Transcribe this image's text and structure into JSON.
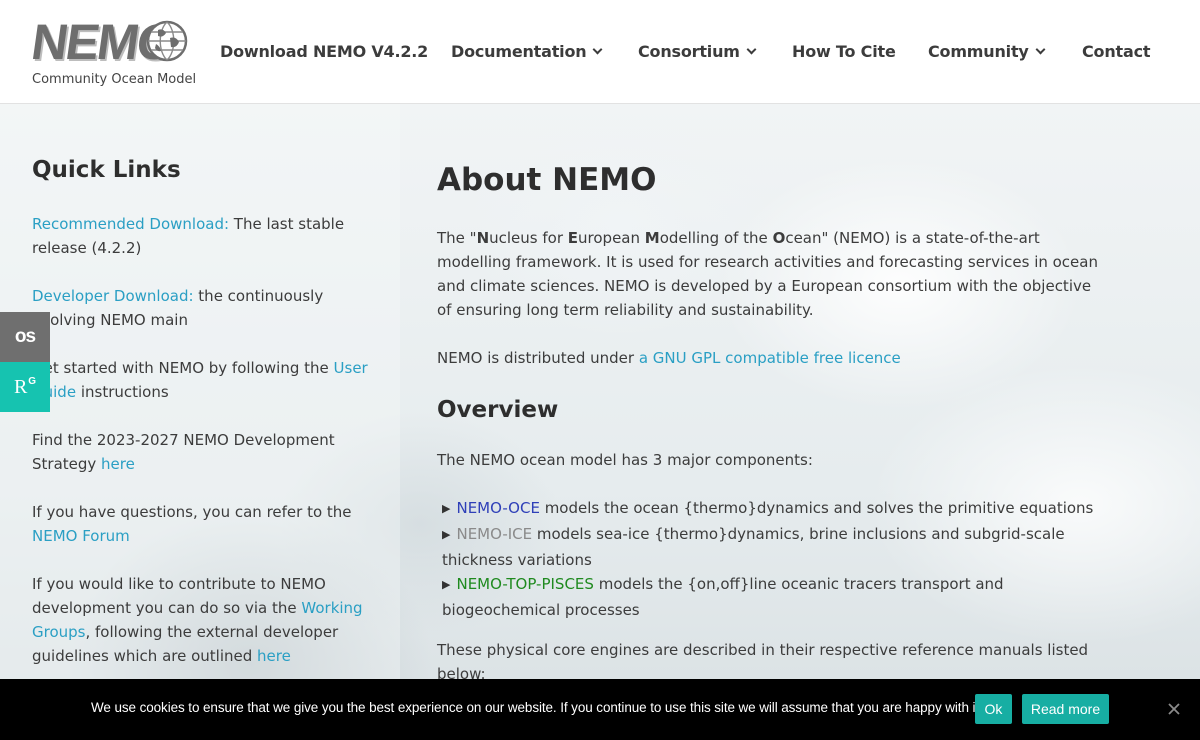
{
  "header": {
    "logo_text": "NEMO",
    "logo_subtitle": "Community Ocean Model",
    "nav": [
      {
        "label": "Download NEMO V4.2.2",
        "dropdown": false
      },
      {
        "label": "Documentation",
        "dropdown": true
      },
      {
        "label": "Consortium",
        "dropdown": true
      },
      {
        "label": "How To Cite",
        "dropdown": false
      },
      {
        "label": "Community",
        "dropdown": true
      },
      {
        "label": "Contact",
        "dropdown": false
      }
    ]
  },
  "sidebar": {
    "title": "Quick Links",
    "items": [
      {
        "link": "Recommended Download:",
        "text": " The last stable release (4.2.2)"
      },
      {
        "link": "Developer Download:",
        "text": " the continuously evolving NEMO main"
      },
      {
        "pre": "Get started with NEMO by following the ",
        "link": "User Guide",
        "text": " instructions"
      },
      {
        "pre": "Find the 2023-2027 NEMO Development Strategy ",
        "link": "here",
        "text": ""
      },
      {
        "pre": "If you have questions, you can refer to the ",
        "link": "NEMO Forum",
        "text": ""
      },
      {
        "pre": "If you would like to contribute to NEMO development you can do so via the ",
        "link": "Working Groups",
        "mid": ", following the external developer guidelines which are outlined ",
        "link2": "here"
      }
    ]
  },
  "main": {
    "title": "About NEMO",
    "about": {
      "q_open": "The \"",
      "N": "N",
      "n_rest": "ucleus for ",
      "E": "E",
      "e_rest": "uropean ",
      "M": "M",
      "m_rest": "odelling of the ",
      "O": "O",
      "o_rest": "cean\" (NEMO) is a state-of-the-art modelling framework. It is used for research activities and forecasting services in ocean and climate sciences. NEMO is developed by a European consortium with the objective of ensuring long term reliability and sustainability."
    },
    "licence_pre": "NEMO is distributed under ",
    "licence_link": "a GNU GPL compatible free licence",
    "overview_title": "Overview",
    "overview_intro": "The NEMO ocean model has 3 major components:",
    "components": [
      {
        "name": "NEMO-OCE",
        "desc": " models the ocean {thermo}dynamics and solves the primitive equations",
        "color": "#2e3fb8"
      },
      {
        "name": "NEMO-ICE",
        "desc": " models sea-ice {thermo}dynamics, brine inclusions and subgrid-scale thickness variations",
        "color": "#8a8a8a"
      },
      {
        "name": "NEMO-TOP-PISCES",
        "desc": " models the {on,off}line oceanic tracers transport and biogeochemical processes",
        "color": "#1f8a1f"
      }
    ],
    "engines_text": "These physical core engines are described in their respective reference manuals listed below:"
  },
  "social": {
    "os_label": "OS",
    "rg_label": "R",
    "rg_sup": "G"
  },
  "cookie": {
    "text": "We use cookies to ensure that we give you the best experience on our website. If you continue to use this site we will assume that you are happy with it.",
    "ok_label": "Ok",
    "more_label": "Read more"
  },
  "colors": {
    "link": "#2a9fc4",
    "accent": "#17aea3",
    "rg": "#16c3b0"
  }
}
